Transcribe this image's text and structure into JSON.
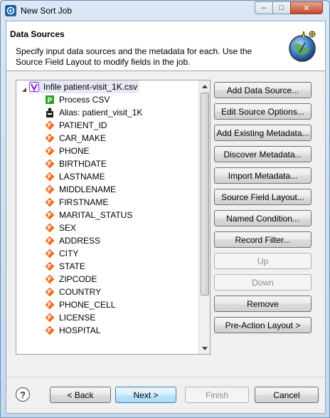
{
  "window": {
    "title": "New Sort Job",
    "min_glyph": "–",
    "max_glyph": "□",
    "close_glyph": "✕"
  },
  "header": {
    "title": "Data Sources",
    "description": "Specify input data sources and the metadata for each. Use the Source Field Layout to modify fields in the job."
  },
  "tree": {
    "root": {
      "label": "Infile patient-visit_1K.csv",
      "icon": "v-source-icon"
    },
    "children": [
      {
        "label": "Process CSV",
        "icon": "process-icon"
      },
      {
        "label": "Alias: patient_visit_1K",
        "icon": "alias-icon"
      }
    ],
    "fields": [
      "PATIENT_ID",
      "CAR_MAKE",
      "PHONE",
      "BIRTHDATE",
      "LASTNAME",
      "MIDDLENAME",
      "FIRSTNAME",
      "MARITAL_STATUS",
      "SEX",
      "ADDRESS",
      "CITY",
      "STATE",
      "ZIPCODE",
      "COUNTRY",
      "PHONE_CELL",
      "LICENSE",
      "HOSPITAL"
    ]
  },
  "side_buttons": [
    {
      "label": "Add Data Source...",
      "name": "add-data-source-button",
      "enabled": true
    },
    {
      "label": "Edit Source Options...",
      "name": "edit-source-options-button",
      "enabled": true
    },
    {
      "label": "Add Existing Metadata...",
      "name": "add-existing-metadata-button",
      "enabled": true
    },
    {
      "label": "Discover Metadata...",
      "name": "discover-metadata-button",
      "enabled": true
    },
    {
      "label": "Import Metadata...",
      "name": "import-metadata-button",
      "enabled": true
    },
    {
      "label": "Source Field Layout...",
      "name": "source-field-layout-button",
      "enabled": true
    },
    {
      "label": "Named Condition...",
      "name": "named-condition-button",
      "enabled": true
    },
    {
      "label": "Record Filter...",
      "name": "record-filter-button",
      "enabled": true
    },
    {
      "label": "Up",
      "name": "up-button",
      "enabled": false
    },
    {
      "label": "Down",
      "name": "down-button",
      "enabled": false
    },
    {
      "label": "Remove",
      "name": "remove-button",
      "enabled": true
    },
    {
      "label": "Pre-Action Layout >",
      "name": "pre-action-layout-button",
      "enabled": true
    }
  ],
  "footer": {
    "help": "?",
    "back": "< Back",
    "next": "Next >",
    "finish": "Finish",
    "cancel": "Cancel"
  },
  "colors": {
    "field_icon": "#f26d21",
    "process_icon": "#2aa52a",
    "source_icon": "#8a2be2",
    "accent_border": "#3c7fb1"
  }
}
